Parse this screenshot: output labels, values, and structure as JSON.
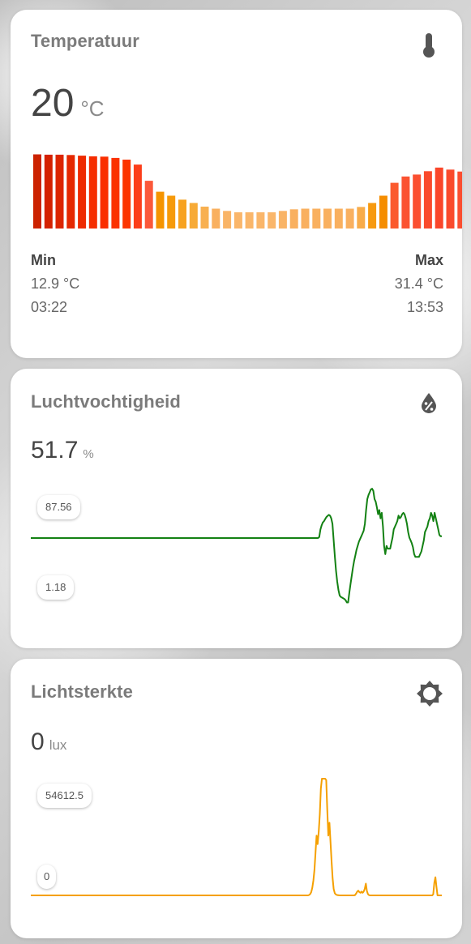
{
  "temperature": {
    "title": "Temperatuur",
    "value": "20",
    "unit": "°C",
    "icon": "thermometer-icon",
    "min_label": "Min",
    "min_value": "12.9 °C",
    "min_time": "03:22",
    "max_label": "Max",
    "max_value": "31.4 °C",
    "max_time": "13:53"
  },
  "humidity": {
    "title": "Luchtvochtigheid",
    "value": "51.7",
    "unit": "%",
    "icon": "water-percent-icon",
    "max_badge": "87.56",
    "min_badge": "1.18",
    "line_color": "#138113"
  },
  "light": {
    "title": "Lichtsterkte",
    "value": "0",
    "unit": "lux",
    "icon": "brightness-icon",
    "max_badge": "54612.5",
    "min_badge": "0",
    "line_color": "#f5a000"
  },
  "chart_data": [
    {
      "type": "bar",
      "name": "temperature-history",
      "values": [
        31.4,
        31.3,
        31.3,
        31.2,
        31.0,
        30.8,
        30.7,
        30.3,
        29.8,
        28.3,
        23.4,
        20.1,
        18.9,
        17.7,
        16.7,
        15.6,
        15.0,
        14.3,
        13.9,
        13.9,
        13.9,
        13.9,
        14.3,
        14.8,
        15.0,
        15.0,
        15.0,
        15.0,
        15.0,
        15.5,
        16.7,
        18.9,
        22.8,
        24.7,
        25.3,
        26.3,
        27.4,
        26.8,
        26.2,
        24.9
      ],
      "ylim": [
        9,
        32
      ],
      "colors": [
        "#cc2200",
        "#d42100",
        "#dc2500",
        "#e52800",
        "#ee2a00",
        "#f52d00",
        "#fa2f00",
        "#fb3200",
        "#fc3500",
        "#fc3e1a",
        "#fb583a",
        "#f59400",
        "#f69a0a",
        "#f7a220",
        "#f7aa36",
        "#f8b050",
        "#f9b05f",
        "#f9b466",
        "#fab66a",
        "#fab66a",
        "#fab66a",
        "#fab66a",
        "#f9b466",
        "#f9b05f",
        "#f9b05f",
        "#f9b05f",
        "#f9b05f",
        "#f9b05f",
        "#f9b05f",
        "#f8ac4a",
        "#f79a10",
        "#f58d00",
        "#fb5a2e",
        "#fb5331",
        "#fb4f30",
        "#fa4a2c",
        "#fa462a",
        "#fa4a2c",
        "#fa4e30",
        "#fa573a"
      ]
    },
    {
      "type": "line",
      "name": "humidity-history",
      "ylim": [
        1.18,
        87.56
      ],
      "values": [
        51.7,
        51.7,
        51.7,
        51.7,
        51.7,
        51.7,
        51.7,
        51.7,
        51.7,
        51.7,
        51.7,
        51.7,
        51.7,
        51.7,
        51.7,
        51.7,
        51.7,
        51.7,
        51.7,
        51.7,
        51.7,
        51.7,
        51.7,
        51.7,
        51.7,
        51.7,
        51.7,
        51.7,
        51.7,
        51.7,
        51.7,
        51.7,
        51.7,
        51.7,
        51.7,
        51.7,
        51.7,
        51.7,
        51.7,
        51.7,
        51.7,
        51.7,
        51.7,
        51.7,
        51.7,
        51.7,
        51.7,
        51.7,
        51.7,
        51.7,
        51.7,
        51.7,
        51.7,
        51.7,
        51.7,
        51.7,
        51.7,
        51.7,
        51.7,
        51.7,
        51.7,
        51.7,
        51.7,
        51.7,
        51.7,
        51.7,
        51.7,
        51.7,
        51.7,
        51.7,
        51.7,
        51.7,
        51.7,
        51.7,
        51.7,
        51.7,
        51.7,
        51.7,
        51.7,
        51.7,
        51.7,
        51.7,
        51.7,
        51.7,
        51.7,
        51.7,
        51.7,
        51.7,
        51.7,
        51.7,
        51.7,
        51.7,
        51.7,
        51.7,
        51.7,
        51.7,
        51.7,
        51.7,
        51.7,
        51.7,
        51.7,
        51.7,
        51.7,
        51.7,
        51.7,
        51.7,
        51.7,
        51.7,
        51.7,
        51.7,
        51.7,
        51.7,
        51.7,
        51.7,
        51.7,
        51.7,
        51.7,
        51.7,
        51.7,
        51.7,
        51.7,
        51.7,
        51.7,
        51.7,
        51.7,
        51.7,
        51.7,
        51.7,
        51.7,
        51.7,
        51.7,
        51.7,
        51.7,
        51.7,
        51.7,
        51.7,
        51.7,
        51.7,
        51.7,
        51.7,
        51.7,
        51.7,
        51.7,
        51.7,
        51.7,
        51.7,
        51.7,
        51.7,
        51.7,
        51.7,
        51.7,
        51.7,
        51.7,
        51.7,
        51.7,
        51.7,
        51.7,
        51.7,
        51.7,
        51.7,
        51.7,
        51.7,
        51.7,
        51.7,
        51.7,
        51.7,
        51.7,
        51.7,
        51.7,
        51.7,
        51.7,
        51.7,
        51.7,
        51.7,
        51.7,
        51.7,
        51.7,
        51.7,
        51.7,
        51.7,
        51.7,
        51.7,
        51.7,
        51.7,
        51.7,
        51.7,
        51.7,
        51.7,
        51.7,
        51.7,
        51.7,
        51.7,
        51.7,
        51.7,
        51.7,
        51.7,
        51.7,
        51.7,
        51.7,
        51.7,
        51.7,
        51.7,
        51.7,
        51.7,
        51.7,
        51.7,
        51.7,
        51.7,
        51.7,
        51.7,
        51.7,
        51.7,
        51.7,
        51.7,
        51.7,
        51.7,
        51.7,
        51.7,
        51.7,
        51.7,
        51.7,
        51.7,
        51.7,
        51.7,
        51.7,
        51.7,
        51.7,
        51.7,
        51.7,
        51.7,
        51.7,
        51.7,
        51.7,
        51.7,
        51.7,
        51.7,
        51.7,
        51.7,
        51.7,
        51.7,
        52.5,
        58.0,
        61.0,
        63.0,
        64.0,
        65.5,
        67.0,
        67.8,
        68.5,
        68.0,
        66.0,
        62.0,
        50.0,
        38.0,
        28.0,
        20.0,
        14.0,
        10.0,
        9.0,
        8.5,
        8.0,
        7.5,
        6.5,
        5.0,
        5.0,
        12.0,
        18.0,
        24.0,
        30.0,
        35.0,
        39.0,
        43.0,
        46.0,
        49.0,
        51.0,
        53.0,
        55.0,
        57.0,
        62.0,
        72.0,
        80.0,
        83.0,
        85.0,
        87.0,
        87.5,
        86.0,
        80.0,
        78.0,
        74.0,
        69.0,
        72.0,
        66.0,
        70.0,
        60.0,
        46.0,
        40.0,
        46.0,
        44.0,
        44.0,
        44.0,
        48.0,
        52.0,
        58.0,
        60.0,
        62.0,
        64.0,
        68.0,
        66.0,
        67.0,
        69.0,
        70.0,
        69.0,
        66.0,
        62.0,
        56.0,
        52.0,
        50.0,
        48.0,
        45.0,
        40.0,
        38.0,
        38.0,
        38.0,
        38.0,
        40.0,
        42.0,
        46.0,
        50.0,
        56.0,
        58.0,
        60.0,
        64.0,
        66.0,
        70.0,
        68.0,
        64.0,
        70.0,
        66.0,
        62.0,
        58.0,
        54.0,
        53.0,
        53.0
      ]
    },
    {
      "type": "line",
      "name": "light-history",
      "ylim": [
        0,
        54612.5
      ],
      "values": [
        0,
        0,
        0,
        0,
        0,
        0,
        0,
        0,
        0,
        0,
        0,
        0,
        0,
        0,
        0,
        0,
        0,
        0,
        0,
        0,
        0,
        0,
        0,
        0,
        0,
        0,
        0,
        0,
        0,
        0,
        0,
        0,
        0,
        0,
        0,
        0,
        0,
        0,
        0,
        0,
        0,
        0,
        0,
        0,
        0,
        0,
        0,
        0,
        0,
        0,
        0,
        0,
        0,
        0,
        0,
        0,
        0,
        0,
        0,
        0,
        0,
        0,
        0,
        0,
        0,
        0,
        0,
        0,
        0,
        0,
        0,
        0,
        0,
        0,
        0,
        0,
        0,
        0,
        0,
        0,
        0,
        0,
        0,
        0,
        0,
        0,
        0,
        0,
        0,
        0,
        0,
        0,
        0,
        0,
        0,
        0,
        0,
        0,
        0,
        0,
        0,
        0,
        0,
        0,
        0,
        0,
        0,
        0,
        0,
        0,
        0,
        0,
        0,
        0,
        0,
        0,
        0,
        0,
        0,
        0,
        0,
        0,
        0,
        0,
        0,
        0,
        0,
        0,
        0,
        0,
        0,
        0,
        0,
        0,
        0,
        0,
        0,
        0,
        0,
        0,
        0,
        0,
        0,
        0,
        0,
        0,
        0,
        0,
        0,
        0,
        0,
        0,
        0,
        0,
        0,
        0,
        0,
        0,
        0,
        0,
        0,
        0,
        0,
        0,
        0,
        0,
        0,
        0,
        0,
        0,
        0,
        0,
        0,
        0,
        0,
        0,
        0,
        0,
        0,
        0,
        0,
        0,
        0,
        0,
        0,
        0,
        0,
        0,
        0,
        0,
        0,
        0,
        0,
        0,
        0,
        0,
        0,
        0,
        0,
        0,
        0,
        0,
        0,
        0,
        0,
        0,
        0,
        0,
        0,
        0,
        0,
        0,
        0,
        0,
        0,
        0,
        0,
        0,
        0,
        0,
        0,
        0,
        0,
        0,
        0,
        0,
        0,
        0,
        0,
        0,
        0,
        0,
        0,
        0,
        0,
        0,
        0,
        0,
        0,
        0,
        0,
        0,
        0,
        0,
        0,
        0,
        0,
        0,
        0,
        0,
        0,
        0,
        0,
        0,
        0,
        0,
        0,
        0,
        0,
        0,
        200,
        600,
        1500,
        3500,
        7000,
        12000,
        20000,
        28000,
        24000,
        30000,
        38000,
        50000,
        54600,
        54600,
        54600,
        54600,
        54000,
        40000,
        28000,
        34000,
        25000,
        16000,
        8000,
        3000,
        1000,
        400,
        200,
        100,
        50,
        0,
        0,
        0,
        0,
        0,
        0,
        0,
        0,
        0,
        0,
        0,
        0,
        0,
        0,
        200,
        900,
        1800,
        2200,
        1500,
        1200,
        1800,
        1200,
        1800,
        3000,
        5500,
        2000,
        600,
        100,
        0,
        0,
        0,
        0,
        0,
        0,
        0,
        0,
        0,
        0,
        0,
        0,
        0,
        0,
        0,
        0,
        0,
        0,
        0,
        0,
        0,
        0,
        0,
        0,
        0,
        0,
        0,
        0,
        0,
        0,
        0,
        0,
        0,
        0,
        0,
        0,
        0,
        0,
        0,
        0,
        0,
        0,
        0,
        0,
        0,
        0,
        0,
        0,
        0,
        0,
        0,
        0,
        0,
        0,
        0,
        0,
        0,
        0,
        0,
        500,
        6000,
        8500,
        4000,
        0,
        0,
        0,
        0,
        0
      ]
    }
  ]
}
